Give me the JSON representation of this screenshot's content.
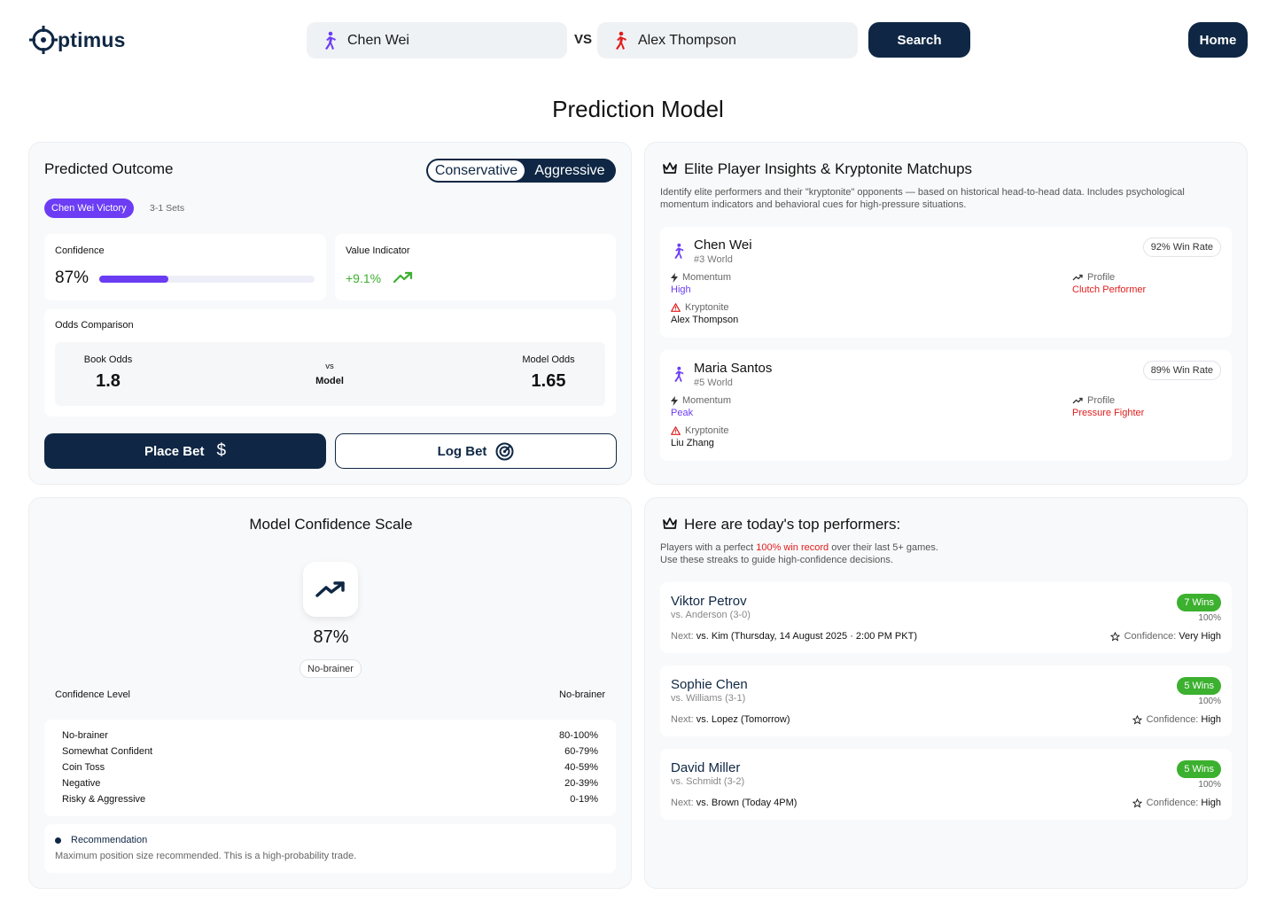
{
  "header": {
    "logo_text": "ptimus",
    "player_a": "Chen Wei",
    "vs": "VS",
    "player_b": "Alex Thompson",
    "search_label": "Search",
    "home_label": "Home"
  },
  "page_title": "Prediction Model",
  "predicted_outcome": {
    "title": "Predicted Outcome",
    "toggle": {
      "conservative": "Conservative",
      "aggressive": "Aggressive",
      "selected": "Conservative"
    },
    "outcome_badge": "Chen Wei Victory",
    "sets": "3-1 Sets",
    "confidence_label": "Confidence",
    "confidence_value": "87%",
    "confidence_fraction": 0.32,
    "value_indicator_label": "Value Indicator",
    "value_indicator_value": "+9.1%",
    "odds_comparison_label": "Odds Comparison",
    "book_odds_label": "Book Odds",
    "book_odds_value": "1.8",
    "vs_small": "vs",
    "model_small": "Model",
    "model_odds_label": "Model Odds",
    "model_odds_value": "1.65",
    "place_bet_label": "Place Bet",
    "log_bet_label": "Log Bet"
  },
  "elite_insights": {
    "title": "Elite Player Insights & Kryptonite Matchups",
    "description_line1": "Identify elite performers and their \"kryptonite\" opponents — based on historical head-to-head data. Includes psychological",
    "description_line2": "momentum indicators and behavioral cues for high-pressure situations.",
    "momentum_key": "Momentum",
    "profile_key": "Profile",
    "kryptonite_key": "Kryptonite",
    "players": [
      {
        "name": "Chen Wei",
        "rank": "#3 World",
        "win_rate": "92% Win Rate",
        "momentum": "High",
        "profile": "Clutch Performer",
        "kryptonite": "Alex Thompson"
      },
      {
        "name": "Maria Santos",
        "rank": "#5 World",
        "win_rate": "89% Win Rate",
        "momentum": "Peak",
        "profile": "Pressure Fighter",
        "kryptonite": "Liu Zhang"
      }
    ]
  },
  "confidence_scale": {
    "title": "Model Confidence Scale",
    "value": "87%",
    "tag": "No-brainer",
    "level_label": "Confidence Level",
    "level_value": "No-brainer",
    "levels": [
      {
        "name": "No-brainer",
        "range": "80-100%"
      },
      {
        "name": "Somewhat Confident",
        "range": "60-79%"
      },
      {
        "name": "Coin Toss",
        "range": "40-59%"
      },
      {
        "name": "Negative",
        "range": "20-39%"
      },
      {
        "name": "Risky & Aggressive",
        "range": "0-19%"
      }
    ],
    "recommendation_title": "Recommendation",
    "recommendation_text": "Maximum position size recommended. This is a high-probability trade."
  },
  "top_performers": {
    "title": "Here are today's top performers:",
    "desc_pre": "Players with a perfect ",
    "desc_highlight": "100% win record",
    "desc_post": " over their last 5+ games.",
    "desc_line2": "Use these streaks to guide high-confidence decisions.",
    "next_key": "Next:",
    "confidence_key": "Confidence:",
    "players": [
      {
        "name": "Viktor Petrov",
        "vs": "vs. Anderson (3-0)",
        "wins": "7 Wins",
        "pct": "100%",
        "next": "vs. Kim (Thursday, 14 August 2025 · 2:00 PM PKT)",
        "confidence": "Very High"
      },
      {
        "name": "Sophie Chen",
        "vs": "vs. Williams (3-1)",
        "wins": "5 Wins",
        "pct": "100%",
        "next": "vs. Lopez (Tomorrow)",
        "confidence": "High"
      },
      {
        "name": "David Miller",
        "vs": "vs. Schmidt (3-2)",
        "wins": "5 Wins",
        "pct": "100%",
        "next": "vs. Brown (Today 4PM)",
        "confidence": "High"
      }
    ]
  },
  "colors": {
    "navy": "#0f2744",
    "purple": "#6c3df5",
    "red": "#e11d1d",
    "green": "#3cb02f"
  }
}
